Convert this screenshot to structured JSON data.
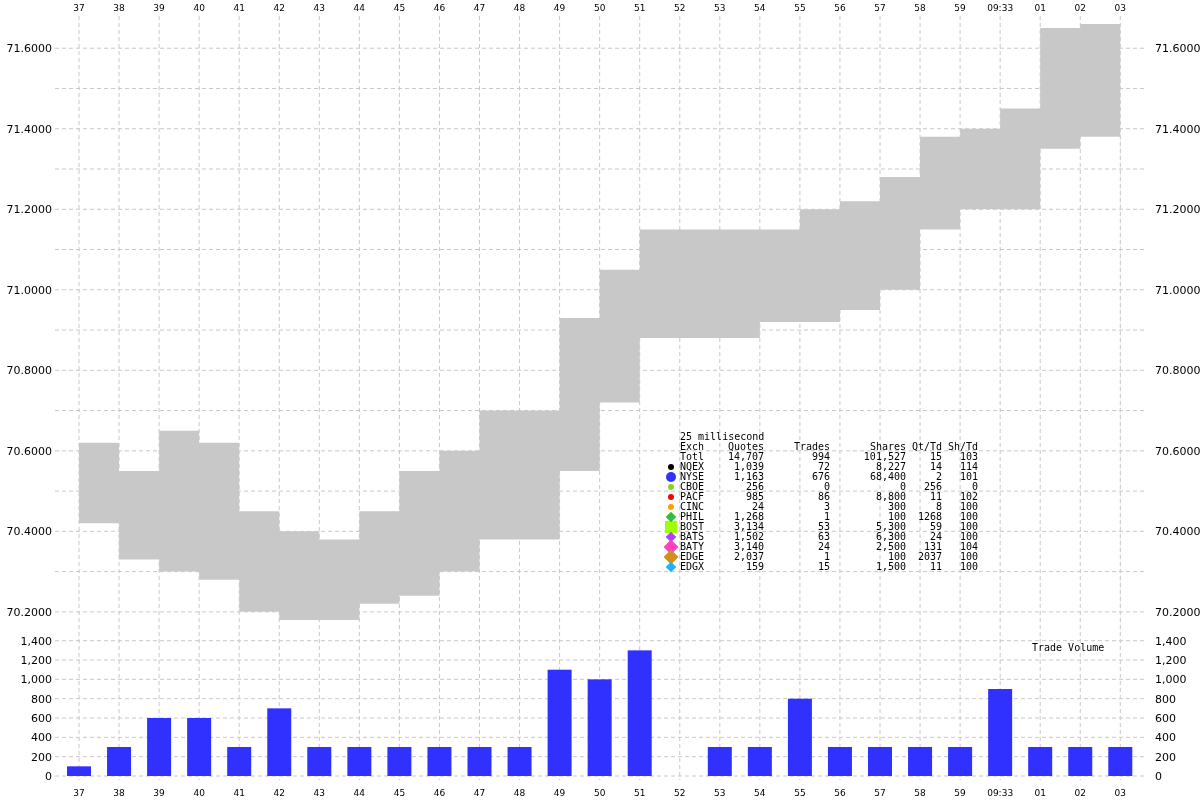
{
  "price_chart": {
    "chart_data": {
      "type": "area",
      "categories": [
        "37",
        "38",
        "39",
        "40",
        "41",
        "42",
        "43",
        "44",
        "45",
        "46",
        "47",
        "48",
        "49",
        "50",
        "51",
        "52",
        "53",
        "54",
        "55",
        "56",
        "57",
        "58",
        "59",
        "09:33",
        "01",
        "02",
        "03"
      ],
      "series": [
        {
          "color": "#c8c8c8",
          "values": [
            70.62,
            70.55,
            70.65,
            70.62,
            70.45,
            70.4,
            70.38,
            70.45,
            70.55,
            70.6,
            70.7,
            70.7,
            70.93,
            71.05,
            71.15,
            71.15,
            71.15,
            71.15,
            71.2,
            71.22,
            71.28,
            71.38,
            71.4,
            71.45,
            71.65,
            71.66,
            71.66
          ]
        },
        {
          "values": [
            70.42,
            70.33,
            70.3,
            70.28,
            70.2,
            70.18,
            70.18,
            70.22,
            70.24,
            70.3,
            70.38,
            70.38,
            70.55,
            70.72,
            70.88,
            70.88,
            70.88,
            70.92,
            70.92,
            70.95,
            71,
            71.15,
            71.2,
            71.2,
            71.35,
            71.38,
            71.38
          ]
        }
      ],
      "ylim": [
        70.15,
        71.68
      ],
      "grid": true,
      "yticks": [
        {
          "value": 70.2,
          "label": "70.2000"
        },
        {
          "value": 70.4,
          "label": "70.4000"
        },
        {
          "value": 70.6,
          "label": "70.6000"
        },
        {
          "value": 70.8,
          "label": "70.8000"
        },
        {
          "value": 71,
          "label": "71.0000"
        },
        {
          "value": 71.2,
          "label": "71.2000"
        },
        {
          "value": 71.4,
          "label": "71.4000"
        },
        {
          "value": 71.6,
          "label": "71.6000"
        }
      ]
    }
  },
  "legend": {
    "title": "25 millisecond",
    "columns": [
      "Exch",
      "Quotes",
      "Trades",
      "Shares",
      "Qt/Td",
      "Sh/Td"
    ],
    "rows": [
      {
        "cells": [
          "Totl",
          "14,707",
          "994",
          "101,527",
          "15",
          "103"
        ]
      },
      {
        "cells": [
          "NQEX",
          "1,039",
          "72",
          "8,227",
          "14",
          "114"
        ],
        "marker": {
          "kind": "dot",
          "color": "#000000"
        }
      },
      {
        "cells": [
          "NYSE",
          "1,163",
          "676",
          "68,400",
          "2",
          "101"
        ],
        "marker": {
          "kind": "big-dot",
          "color": "#3030ff"
        }
      },
      {
        "cells": [
          "CBOE",
          "256",
          "0",
          "0",
          "256",
          "0"
        ],
        "marker": {
          "kind": "dot",
          "color": "#90d020"
        }
      },
      {
        "cells": [
          "PACF",
          "985",
          "86",
          "8,800",
          "11",
          "102"
        ],
        "marker": {
          "kind": "dot",
          "color": "#ff0000"
        }
      },
      {
        "cells": [
          "CINC",
          "24",
          "3",
          "300",
          "8",
          "100"
        ],
        "marker": {
          "kind": "dot",
          "color": "#ffa000"
        }
      },
      {
        "cells": [
          "PHIL",
          "1,268",
          "1",
          "100",
          "1268",
          "100"
        ],
        "marker": {
          "kind": "diamond",
          "color": "#30c030"
        }
      },
      {
        "cells": [
          "BOST",
          "3,134",
          "53",
          "5,300",
          "59",
          "100"
        ],
        "marker": {
          "kind": "square",
          "color": "#a0ff00"
        }
      },
      {
        "cells": [
          "BATS",
          "1,502",
          "63",
          "6,300",
          "24",
          "100"
        ],
        "marker": {
          "kind": "diamond",
          "color": "#b040ff"
        }
      },
      {
        "cells": [
          "BATY",
          "3,140",
          "24",
          "2,500",
          "131",
          "104"
        ],
        "marker": {
          "kind": "big-diamond",
          "color": "#ff40c0"
        }
      },
      {
        "cells": [
          "EDGE",
          "2,037",
          "1",
          "100",
          "2037",
          "100"
        ],
        "marker": {
          "kind": "big-diamond",
          "color": "#d09020"
        }
      },
      {
        "cells": [
          "EDGX",
          "159",
          "15",
          "1,500",
          "11",
          "100"
        ],
        "marker": {
          "kind": "diamond",
          "color": "#20b0ff"
        }
      }
    ]
  },
  "volume_chart": {
    "chart_data": {
      "type": "bar",
      "title": "Trade Volume",
      "categories": [
        "37",
        "38",
        "39",
        "40",
        "41",
        "42",
        "43",
        "44",
        "45",
        "46",
        "47",
        "48",
        "49",
        "50",
        "51",
        "52",
        "53",
        "54",
        "55",
        "56",
        "57",
        "58",
        "59",
        "09:33",
        "01",
        "02",
        "03"
      ],
      "series": [
        {
          "color": "#3030ff",
          "values": [
            100,
            300,
            600,
            600,
            300,
            700,
            300,
            300,
            300,
            300,
            300,
            300,
            1100,
            1000,
            1300,
            null,
            300,
            300,
            800,
            300,
            300,
            300,
            300,
            900,
            300,
            300,
            300
          ]
        }
      ],
      "ylim": [
        0,
        1490
      ],
      "grid": true,
      "yticks": [
        {
          "value": 0,
          "label": "0"
        },
        {
          "value": 200,
          "label": "200"
        },
        {
          "value": 400,
          "label": "400"
        },
        {
          "value": 600,
          "label": "600"
        },
        {
          "value": 800,
          "label": "800"
        },
        {
          "value": 1000,
          "label": "1,000"
        },
        {
          "value": 1200,
          "label": "1,200"
        },
        {
          "value": 1400,
          "label": "1,400"
        }
      ]
    }
  }
}
